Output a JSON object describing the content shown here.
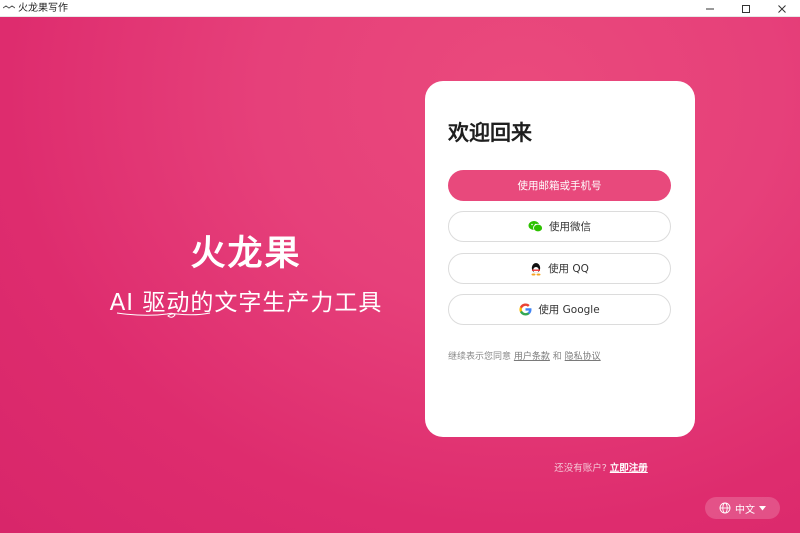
{
  "window": {
    "title": "火龙果写作",
    "controls": [
      "minimize-icon",
      "maximize-icon",
      "close-icon"
    ]
  },
  "brand": {
    "name": "火龙果",
    "slogan": "AI 驱动的文字生产力工具"
  },
  "login": {
    "heading": "欢迎回来",
    "buttons": [
      {
        "label": "使用邮箱或手机号",
        "icon": ""
      },
      {
        "label": "使用微信",
        "icon": "wechat-icon"
      },
      {
        "label": "使用 QQ",
        "icon": "qq-icon"
      },
      {
        "label": "使用 Google",
        "icon": "google-icon"
      }
    ],
    "legal": {
      "prefix": "继续表示您同意",
      "terms": "用户条款",
      "and": "和",
      "privacy": "隐私协议"
    }
  },
  "signup": {
    "prompt": "还没有账户?",
    "link": "立即注册"
  },
  "language": {
    "current": "中文",
    "icon": "globe-icon"
  },
  "colors": {
    "brand_pink": "#e6407a",
    "primary_button": "#e8497c"
  }
}
